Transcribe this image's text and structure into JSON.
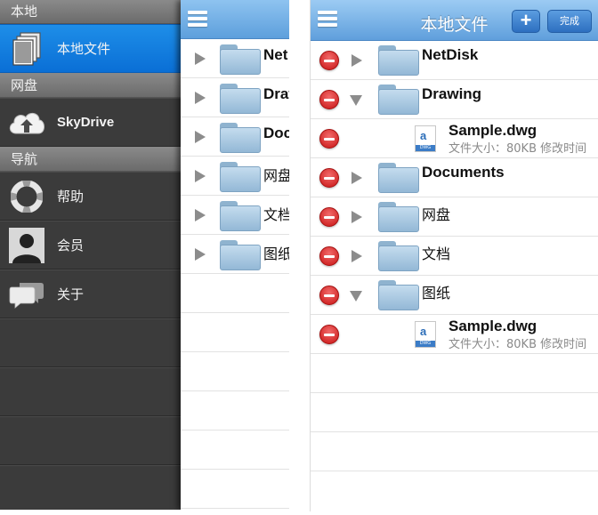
{
  "sidebar": {
    "sections": [
      {
        "header": "本地",
        "items": [
          {
            "label": "本地文件",
            "icon": "documents-icon",
            "active": true
          }
        ]
      },
      {
        "header": "网盘",
        "items": [
          {
            "label": "SkyDrive",
            "icon": "cloud-upload-icon"
          }
        ]
      },
      {
        "header": "导航",
        "items": [
          {
            "label": "帮助",
            "icon": "lifebuoy-icon"
          },
          {
            "label": "会员",
            "icon": "user-silhouette-icon"
          },
          {
            "label": "关于",
            "icon": "speech-bubbles-icon"
          }
        ]
      }
    ]
  },
  "left_list": {
    "rows": [
      "Net",
      "Draw",
      "Doc",
      "网盘",
      "文档",
      "图纸"
    ]
  },
  "right": {
    "nav": {
      "title": "本地文件",
      "add_label": "+",
      "done_label": "完成"
    },
    "rows": [
      {
        "type": "folder",
        "name": "NetDisk",
        "expanded": false
      },
      {
        "type": "folder",
        "name": "Drawing",
        "expanded": true
      },
      {
        "type": "file",
        "name": "Sample.dwg",
        "meta": "文件大小：80KB  修改时间"
      },
      {
        "type": "folder",
        "name": "Documents",
        "expanded": false
      },
      {
        "type": "folder",
        "name": "网盘",
        "expanded": false
      },
      {
        "type": "folder",
        "name": "文档",
        "expanded": false
      },
      {
        "type": "folder",
        "name": "图纸",
        "expanded": true
      },
      {
        "type": "file",
        "name": "Sample.dwg",
        "meta": "文件大小：80KB  修改时间"
      }
    ]
  },
  "colors": {
    "accent_blue": "#1b87e6",
    "nav_blue": "#6aa8e0",
    "delete_red": "#d9201f"
  }
}
